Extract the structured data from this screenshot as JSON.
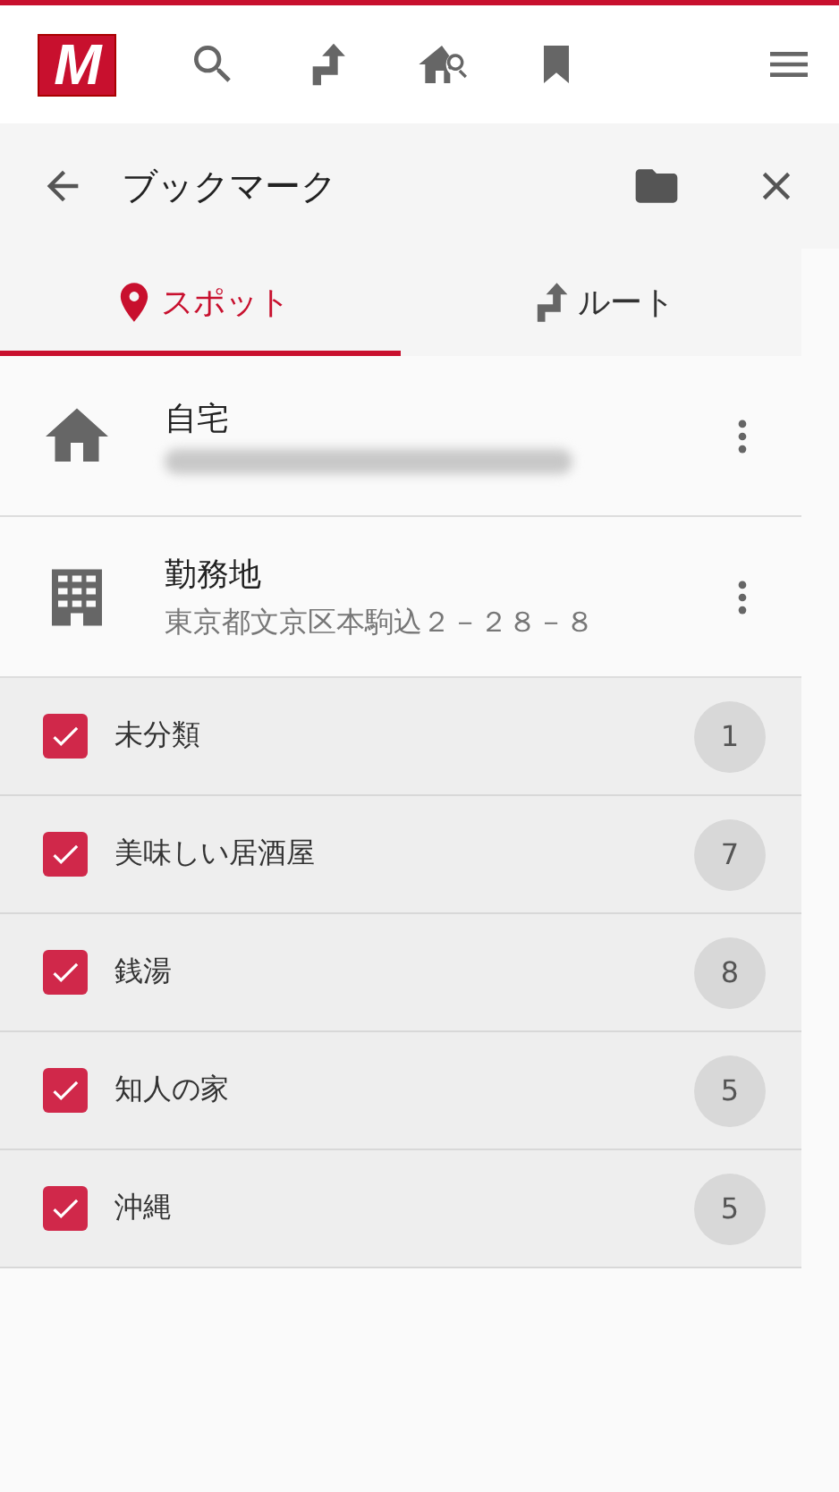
{
  "header": {
    "logo": "M"
  },
  "title_bar": {
    "title": "ブックマーク"
  },
  "tabs": [
    {
      "kind": "spot",
      "label": "スポット",
      "selected": true
    },
    {
      "kind": "route",
      "label": "ルート",
      "selected": false
    }
  ],
  "spots": [
    {
      "kind": "home",
      "name": "自宅",
      "address_blurred": true
    },
    {
      "kind": "office",
      "name": "勤務地",
      "address": "東京都文京区本駒込２－２８－８",
      "address_blurred": false
    }
  ],
  "folders": [
    {
      "name": "未分類",
      "checked": true,
      "count": "1"
    },
    {
      "name": "美味しい居酒屋",
      "checked": true,
      "count": "7"
    },
    {
      "name": "銭湯",
      "checked": true,
      "count": "8"
    },
    {
      "name": "知人の家",
      "checked": true,
      "count": "5"
    },
    {
      "name": "沖縄",
      "checked": true,
      "count": "5"
    }
  ]
}
